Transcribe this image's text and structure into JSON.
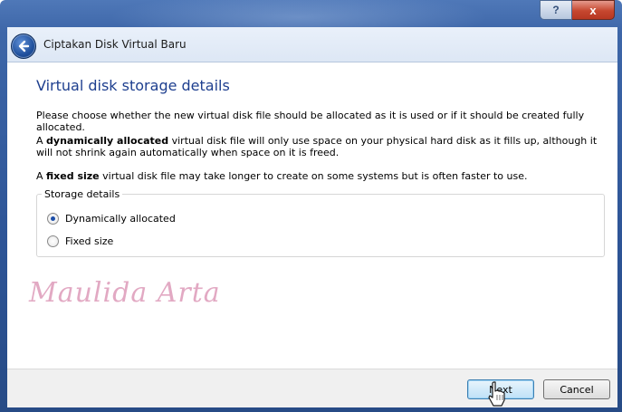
{
  "window": {
    "title": "Ciptakan Disk Virtual Baru",
    "help_label": "?",
    "close_label": "x"
  },
  "page": {
    "heading": "Virtual disk storage details",
    "intro": "Please choose whether the new virtual disk file should be allocated as it is used or if it should be created fully allocated.",
    "dynamic_lead": "A ",
    "dynamic_bold": "dynamically allocated",
    "dynamic_rest": " virtual disk file will only use space on your physical hard disk as it fills up, although it will not shrink again automatically when space on it is freed.",
    "fixed_lead": "A ",
    "fixed_bold": "fixed size",
    "fixed_rest": " virtual disk file may take longer to create on some systems but is often faster to use."
  },
  "storage": {
    "group_label": "Storage details",
    "options": [
      {
        "label": "Dynamically allocated",
        "selected": true
      },
      {
        "label": "Fixed size",
        "selected": false
      }
    ]
  },
  "watermark": "Maulida Arta",
  "footer": {
    "next_label": "Next",
    "cancel_label": "Cancel"
  },
  "colors": {
    "heading": "#1e3f8f",
    "accent": "#3c7fb1"
  },
  "icons": {
    "back": "back-arrow-icon",
    "cursor": "hand-pointer-icon"
  }
}
